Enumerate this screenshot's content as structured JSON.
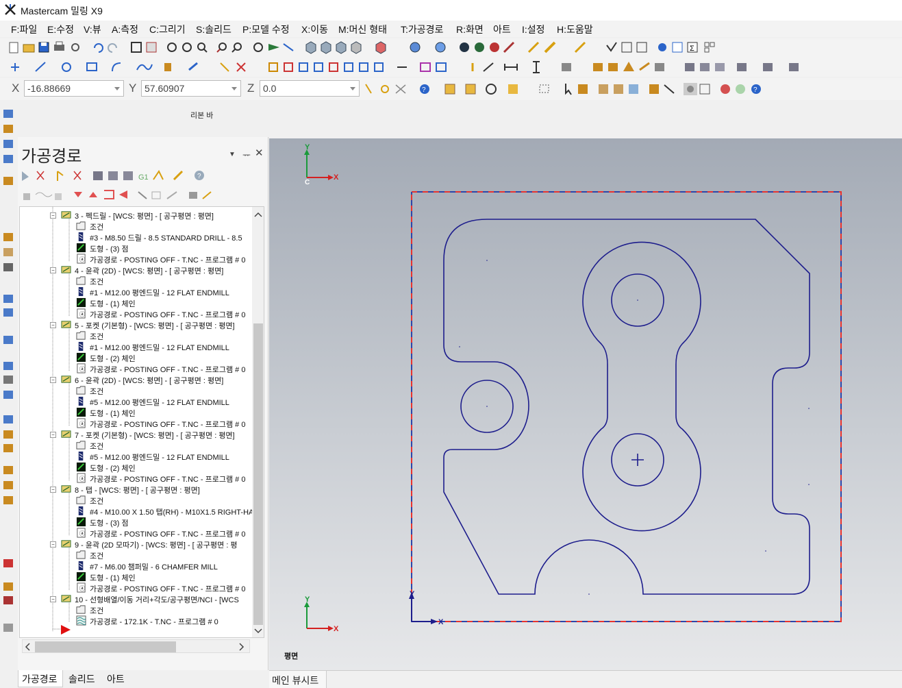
{
  "window": {
    "title": "Mastercam 밀링 X9"
  },
  "menu": [
    {
      "label": "F:파일"
    },
    {
      "label": "E:수정"
    },
    {
      "label": "V:뷰"
    },
    {
      "label": "A:측정"
    },
    {
      "label": "C:그리기"
    },
    {
      "label": "S:솔리드"
    },
    {
      "label": "P:모델 수정"
    },
    {
      "label": "X:이동"
    },
    {
      "label": "M:머신 형태"
    },
    {
      "label": "T:가공경로"
    },
    {
      "label": "R:화면"
    },
    {
      "label": "아트"
    },
    {
      "label": "I:설정"
    },
    {
      "label": "H:도움말"
    }
  ],
  "coords": {
    "x_label": "X",
    "x_value": "-16.88669",
    "y_label": "Y",
    "y_value": "57.60907",
    "z_label": "Z",
    "z_value": "0.0"
  },
  "ribbon_label": "리본 바",
  "panel": {
    "title": "가공경로",
    "pin": "ᅲ",
    "close": "✕",
    "menu": "▼"
  },
  "tree": [
    {
      "type": "op",
      "text": "3 - 펙드릴 - [WCS: 평면] - [ 공구평면 : 평면]"
    },
    {
      "type": "param",
      "text": "조건"
    },
    {
      "type": "tool",
      "text": "#3 - M8.50 드릴 - 8.5 STANDARD DRILL - 8.5"
    },
    {
      "type": "geo",
      "text": "도형 - (3) 점"
    },
    {
      "type": "path",
      "text": "가공경로 - POSTING OFF - T.NC - 프로그램 # 0"
    },
    {
      "type": "op",
      "text": "4 - 윤곽 (2D) - [WCS: 평면] - [ 공구평면 : 평면]"
    },
    {
      "type": "param",
      "text": "조건"
    },
    {
      "type": "tool",
      "text": "#1 - M12.00 평엔드밀 - 12 FLAT ENDMILL"
    },
    {
      "type": "geo",
      "text": "도형 - (1) 체인"
    },
    {
      "type": "path",
      "text": "가공경로 - POSTING OFF - T.NC - 프로그램 # 0"
    },
    {
      "type": "op",
      "text": "5 - 포켓 (기본형) - [WCS: 평면] - [ 공구평면 : 평면]"
    },
    {
      "type": "param",
      "text": "조건"
    },
    {
      "type": "tool",
      "text": "#1 - M12.00 평엔드밀 - 12 FLAT ENDMILL"
    },
    {
      "type": "geo",
      "text": "도형 - (2) 체인"
    },
    {
      "type": "path",
      "text": "가공경로 - POSTING OFF - T.NC - 프로그램 # 0"
    },
    {
      "type": "op",
      "text": "6 - 윤곽 (2D) - [WCS: 평면] - [ 공구평면 : 평면]"
    },
    {
      "type": "param",
      "text": "조건"
    },
    {
      "type": "tool",
      "text": "#5 - M12.00 평엔드밀 - 12 FLAT ENDMILL"
    },
    {
      "type": "geo",
      "text": "도형 - (1) 체인"
    },
    {
      "type": "path",
      "text": "가공경로 - POSTING OFF - T.NC - 프로그램 # 0"
    },
    {
      "type": "op",
      "text": "7 - 포켓 (기본형) - [WCS: 평면] - [ 공구평면 : 평면]"
    },
    {
      "type": "param",
      "text": "조건"
    },
    {
      "type": "tool",
      "text": "#5 - M12.00 평엔드밀 - 12 FLAT ENDMILL"
    },
    {
      "type": "geo",
      "text": "도형 - (2) 체인"
    },
    {
      "type": "path",
      "text": "가공경로 - POSTING OFF - T.NC - 프로그램 # 0"
    },
    {
      "type": "op",
      "text": "8 - 탭 - [WCS: 평면] - [ 공구평면 : 평면]"
    },
    {
      "type": "param",
      "text": "조건"
    },
    {
      "type": "tool",
      "text": "#4 - M10.00 X 1.50 탭(RH) - M10X1.5 RIGHT-HA"
    },
    {
      "type": "geo",
      "text": "도형 - (3) 점"
    },
    {
      "type": "path",
      "text": "가공경로 - POSTING OFF - T.NC - 프로그램 # 0"
    },
    {
      "type": "op",
      "text": "9 - 윤곽 (2D 모따기) - [WCS: 평면] - [ 공구평면 : 평"
    },
    {
      "type": "param",
      "text": "조건"
    },
    {
      "type": "tool",
      "text": "#7 - M6.00 챔퍼밀 - 6 CHAMFER MILL"
    },
    {
      "type": "geo",
      "text": "도형 - (1) 체인"
    },
    {
      "type": "path",
      "text": "가공경로 - POSTING OFF - T.NC - 프로그램 # 0"
    },
    {
      "type": "op",
      "text": "10 - 선형배열/이동 거리+각도/공구평면/NCI - [WCS"
    },
    {
      "type": "param",
      "text": "조건"
    },
    {
      "type": "path2",
      "text": "가공경로 - 172.1K - T.NC - 프로그램 # 0"
    }
  ],
  "bottom_tabs": [
    {
      "label": "가공경로"
    },
    {
      "label": "솔리드"
    },
    {
      "label": "아트"
    }
  ],
  "viewport": {
    "view_name": "평면",
    "gnomon_top": {
      "y": "Y",
      "x": "X",
      "c": "C"
    },
    "gnomon_bottom": {
      "y": "Y",
      "x": "X"
    },
    "origin_axes": {
      "y": "Y",
      "x": "X"
    },
    "tab": "메인 뷰시트"
  },
  "colors": {
    "part_outline": "#1d1d8c",
    "stock_red": "#e8322e",
    "stock_blue": "#2b45a8",
    "axis_green": "#1a9a3a",
    "axis_red": "#d42020"
  }
}
